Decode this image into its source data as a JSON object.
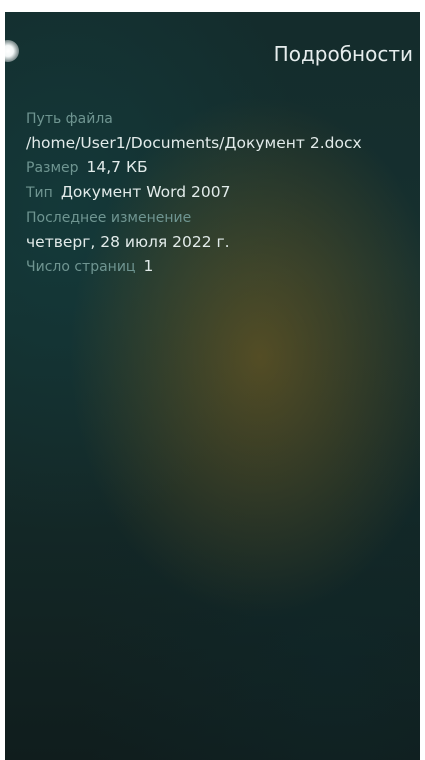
{
  "header": {
    "title": "Подробности",
    "back_icon": "back-icon"
  },
  "details": {
    "path_label": "Путь файла",
    "path_value": "/home/User1/Documents/Документ 2.docx",
    "size_label": "Размер",
    "size_value": "14,7 КБ",
    "type_label": "Тип",
    "type_value": "Документ Word 2007",
    "modified_label": "Последнее изменение",
    "modified_value": "четверг, 28 июля 2022 г.",
    "pages_label": "Число страниц",
    "pages_value": "1"
  }
}
